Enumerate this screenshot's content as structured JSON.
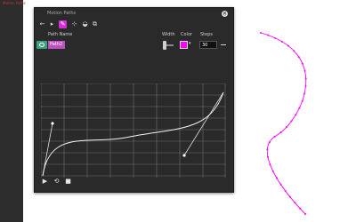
{
  "app": {
    "sidebar_tab": "Motion Paths"
  },
  "panel": {
    "title": "Motion Paths",
    "close_symbol": "✕",
    "toolbar": [
      {
        "name": "back-arrow-icon",
        "glyph": "←"
      },
      {
        "name": "pointer-icon",
        "glyph": "▸"
      },
      {
        "name": "pen-tool-icon",
        "glyph": "✎",
        "active": true
      },
      {
        "name": "add-point-icon",
        "glyph": "⊹"
      },
      {
        "name": "bucket-icon",
        "glyph": "◒"
      },
      {
        "name": "duplicate-icon",
        "glyph": "⧉"
      }
    ],
    "columns": {
      "path_name": "Path Name",
      "width": "Width",
      "color": "Color",
      "steps": "Steps"
    },
    "path": {
      "name": "Path2",
      "color": "#ff00ff",
      "steps": "30",
      "color_dropdown": "▾"
    },
    "playback": {
      "play": "▶",
      "loop": "⟲",
      "stop": "■"
    }
  },
  "colors": {
    "accent": "#d42fd4",
    "path_color": "#ff00ff",
    "visibility": "#3aa37a"
  }
}
